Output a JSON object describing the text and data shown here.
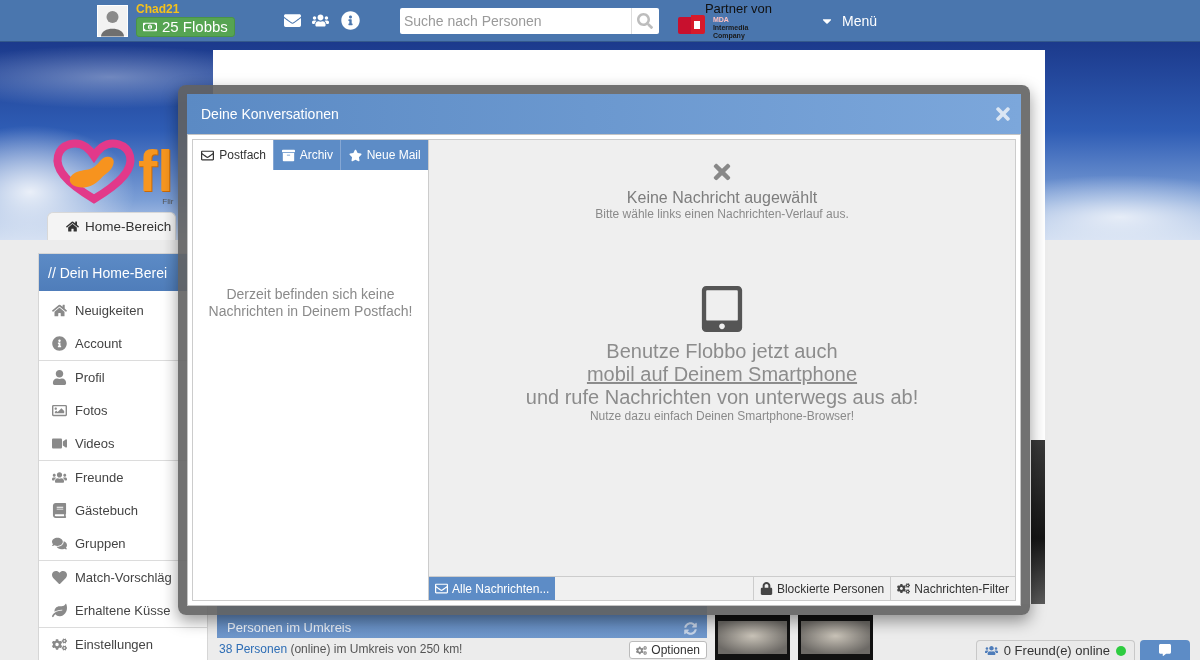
{
  "top_bar": {
    "username": "Chad21",
    "credits": "25 Flobbs",
    "search": {
      "placeholder": "Suche nach Personen"
    },
    "partner": {
      "label": "Partner von",
      "logo_lines": [
        "MDA",
        "Intermedia",
        "Company"
      ]
    },
    "menu": "Menü"
  },
  "logo": {
    "text": "fl",
    "tagline": "Flir"
  },
  "home_tab": "Home-Bereich",
  "sidebar": {
    "title": "// Dein Home-Berei",
    "groups": [
      [
        "Neuigkeiten",
        "Account"
      ],
      [
        "Profil",
        "Fotos",
        "Videos"
      ],
      [
        "Freunde",
        "Gästebuch",
        "Gruppen"
      ],
      [
        "Match-Vorschläg",
        "Erhaltene Küsse"
      ],
      [
        "Einstellungen"
      ]
    ]
  },
  "dialog": {
    "title": "Deine Konversationen",
    "tabs": [
      {
        "label": "Postfach",
        "selected": true
      },
      {
        "label": "Archiv",
        "selected": false
      },
      {
        "label": "Neue Mail",
        "selected": false
      }
    ],
    "empty_inbox": "Derzeit befinden sich keine Nachrichten in Deinem Postfach!",
    "no_selection": {
      "title": "Keine Nachricht augewählt",
      "hint": "Bitte wähle links einen Nachrichten-Verlauf aus."
    },
    "mobile_promo": {
      "line_1": "Benutze Flobbo jetzt auch",
      "link": "mobil auf Deinem Smartphone",
      "line_2": "und rufe Nachrichten von unterwegs aus ab!",
      "note": "Nutze dazu einfach Deinen Smartphone-Browser!"
    },
    "toolbar": [
      {
        "label": "Alle Nachrichten...",
        "selected": true
      },
      {
        "label": "Blockierte Personen",
        "selected": false
      },
      {
        "label": "Nachrichten-Filter",
        "selected": false
      }
    ]
  },
  "nearby": {
    "title": "Personen im Umkreis",
    "link": "38 Personen",
    "text": "(online) im Umkreis von 250 km!",
    "options": "Optionen"
  },
  "chat_bar": {
    "label": "0 Freund(e) online"
  }
}
